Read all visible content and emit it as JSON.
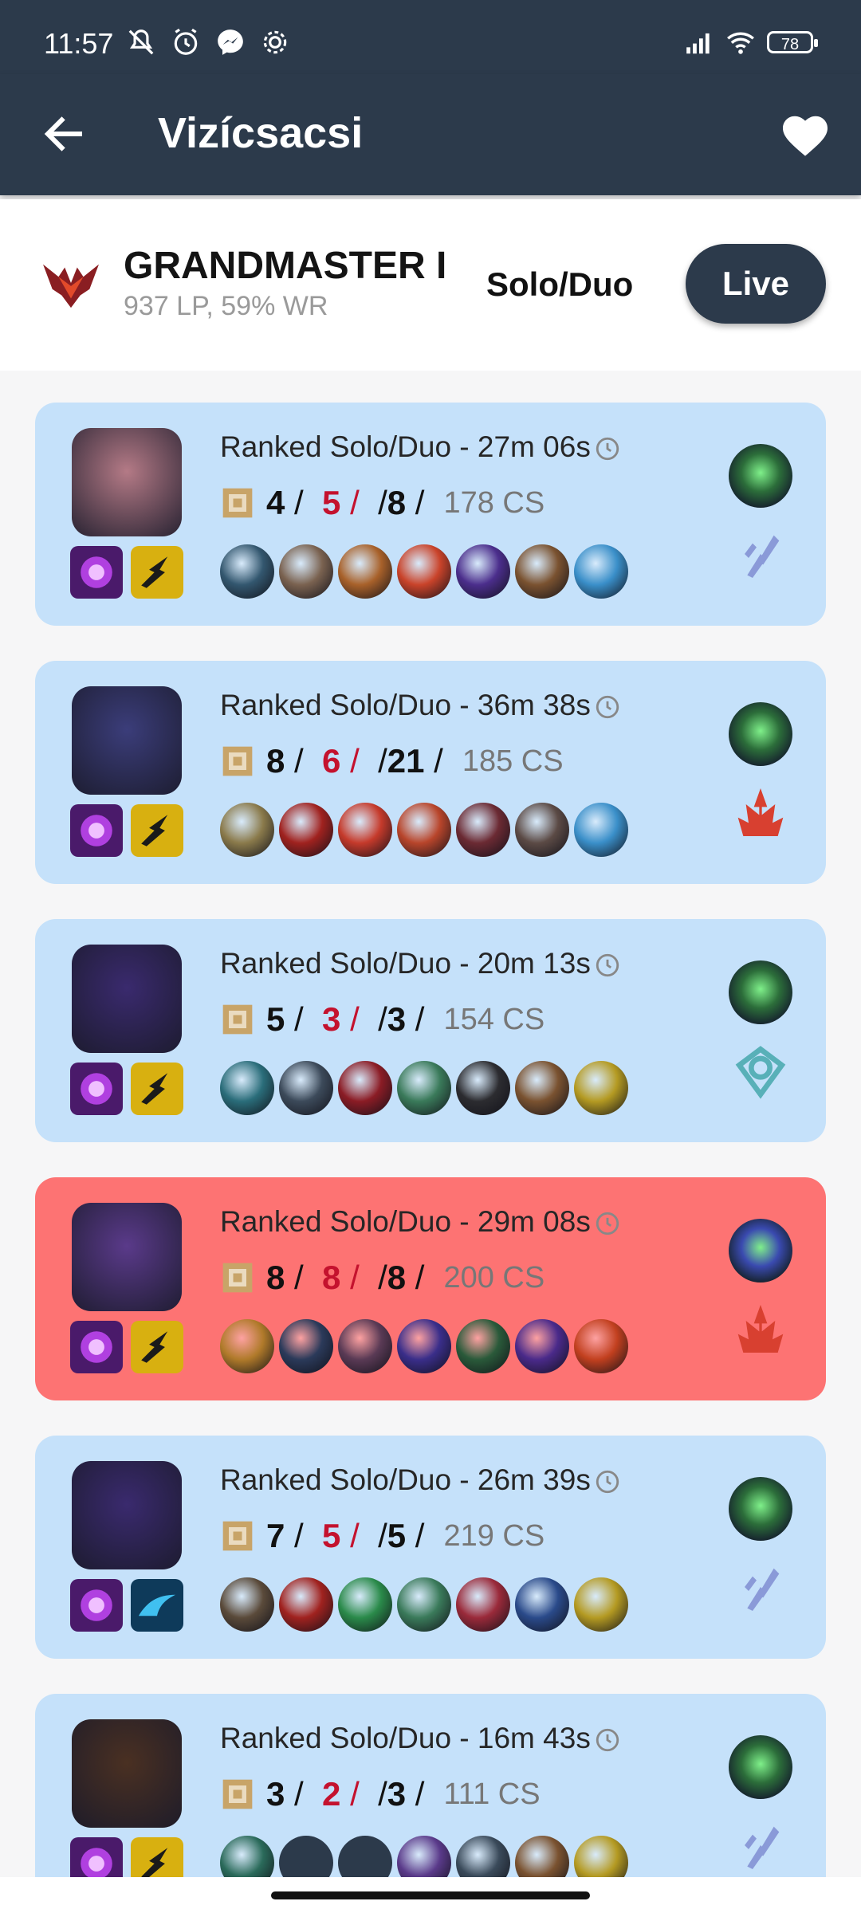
{
  "status_bar": {
    "time": "11:57",
    "battery": "78"
  },
  "app_bar": {
    "title": "Vizícsacsi"
  },
  "rank": {
    "tier": "GRANDMASTER I",
    "details": "937 LP, 59% WR",
    "queue": "Solo/Duo",
    "live_label": "Live"
  },
  "matches": [
    {
      "result": "win",
      "title": "Ranked Solo/Duo - 27m 06s",
      "kills": "4",
      "deaths": "5",
      "assists": "8",
      "cs": "178 CS",
      "champion_color": "#b47a86",
      "spells": [
        "flash",
        "flash-yellow"
      ],
      "item_colors": [
        "#33576f",
        "#7a6250",
        "#a8612a",
        "#c9432a",
        "#4b2e8c",
        "#7a5230",
        "#3a8fc9"
      ],
      "keystone_color": "#2c6e3a",
      "secondary": "sorcery"
    },
    {
      "result": "win",
      "title": "Ranked Solo/Duo - 36m 38s",
      "kills": "8",
      "deaths": "6",
      "assists": "21",
      "cs": "185 CS",
      "champion_color": "#3b3d7a",
      "spells": [
        "flash",
        "flash-yellow"
      ],
      "item_colors": [
        "#8a7a4b",
        "#a0221f",
        "#c53a2b",
        "#b8452b",
        "#6b2a33",
        "#5b4a45",
        "#3a8fc9"
      ],
      "keystone_color": "#2c6e3a",
      "secondary": "domination"
    },
    {
      "result": "win",
      "title": "Ranked Solo/Duo - 20m 13s",
      "kills": "5",
      "deaths": "3",
      "assists": "3",
      "cs": "154 CS",
      "champion_color": "#3a2a6e",
      "spells": [
        "flash",
        "flash-yellow"
      ],
      "item_colors": [
        "#2a6d7a",
        "#3c4a5a",
        "#8b1c25",
        "#3a7a5a",
        "#2c2c30",
        "#7a5230",
        "#b49a22"
      ],
      "keystone_color": "#2c6e3a",
      "secondary": "resolve"
    },
    {
      "result": "loss",
      "title": "Ranked Solo/Duo - 29m 08s",
      "kills": "8",
      "deaths": "8",
      "assists": "8",
      "cs": "200 CS",
      "champion_color": "#5a3a8a",
      "spells": [
        "flash",
        "flash-yellow"
      ],
      "item_colors": [
        "#b07a2a",
        "#2b3a5a",
        "#5a3a55",
        "#3a2e8a",
        "#2a5a3a",
        "#4a2a8a",
        "#c2401f"
      ],
      "keystone_color": "#3a4ab0",
      "secondary": "domination"
    },
    {
      "result": "win",
      "title": "Ranked Solo/Duo - 26m 39s",
      "kills": "7",
      "deaths": "5",
      "assists": "5",
      "cs": "219 CS",
      "champion_color": "#3a2a6e",
      "spells": [
        "flash",
        "ghost"
      ],
      "item_colors": [
        "#5a4a3a",
        "#a0221f",
        "#2a8a4a",
        "#3a7a5a",
        "#9a2a3a",
        "#2a4a8a",
        "#b49a22"
      ],
      "keystone_color": "#2c6e3a",
      "secondary": "sorcery"
    },
    {
      "result": "win",
      "title": "Ranked Solo/Duo - 16m 43s",
      "kills": "3",
      "deaths": "2",
      "assists": "3",
      "cs": "111 CS",
      "champion_color": "#4a3022",
      "spells": [
        "flash",
        "flash-yellow"
      ],
      "item_colors": [
        "#2a6a5a",
        "empty",
        "empty",
        "#5a3a8a",
        "#3a4a5a",
        "#7a5230",
        "#b49a22"
      ],
      "keystone_color": "#2c6e3a",
      "secondary": "sorcery"
    }
  ]
}
